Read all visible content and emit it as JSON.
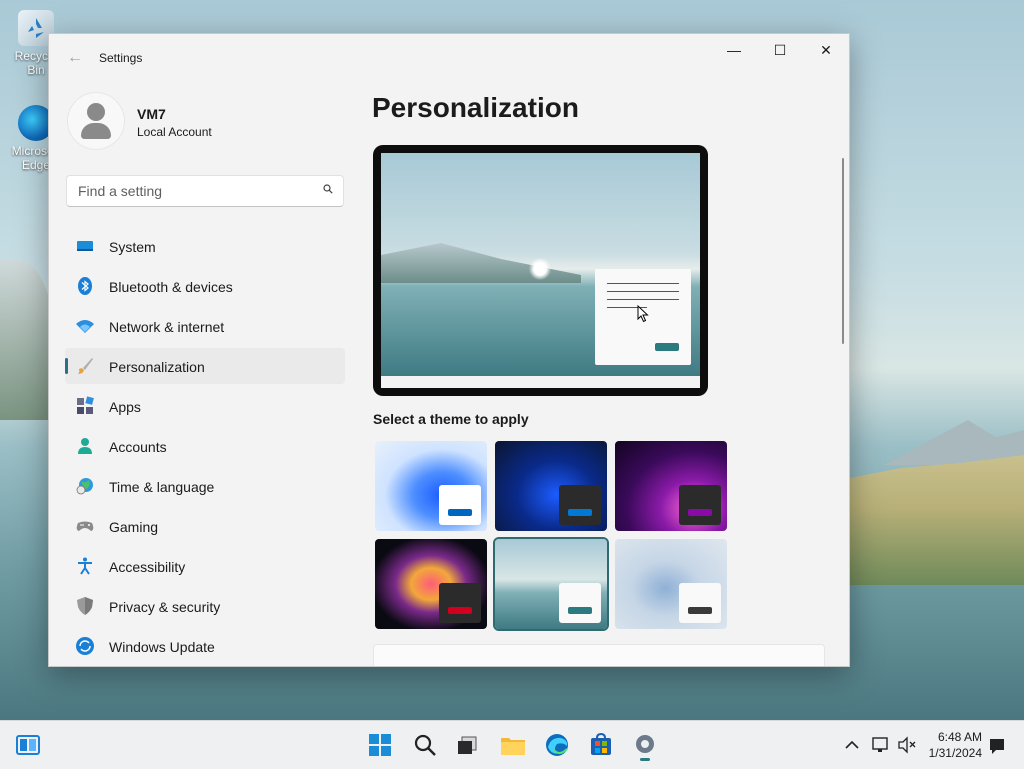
{
  "desktop": {
    "icons": [
      {
        "label": "Recycle Bin"
      },
      {
        "label": "Microsoft Edge"
      }
    ]
  },
  "window": {
    "title": "Settings",
    "controls": {
      "minimize": "—",
      "maximize": "☐",
      "close": "✕"
    },
    "back_glyph": "←"
  },
  "user": {
    "name": "VM7",
    "account_type": "Local Account"
  },
  "search": {
    "placeholder": "Find a setting"
  },
  "sidebar": {
    "items": [
      {
        "label": "System",
        "icon": "monitor-icon"
      },
      {
        "label": "Bluetooth & devices",
        "icon": "bluetooth-icon"
      },
      {
        "label": "Network & internet",
        "icon": "wifi-icon"
      },
      {
        "label": "Personalization",
        "icon": "brush-icon",
        "active": true
      },
      {
        "label": "Apps",
        "icon": "apps-icon"
      },
      {
        "label": "Accounts",
        "icon": "person-icon"
      },
      {
        "label": "Time & language",
        "icon": "globe-clock-icon"
      },
      {
        "label": "Gaming",
        "icon": "gamepad-icon"
      },
      {
        "label": "Accessibility",
        "icon": "accessibility-icon"
      },
      {
        "label": "Privacy & security",
        "icon": "shield-icon"
      },
      {
        "label": "Windows Update",
        "icon": "update-icon"
      }
    ]
  },
  "main": {
    "title": "Personalization",
    "theme_section_label": "Select a theme to apply",
    "themes": [
      {
        "name": "windows-light",
        "accent": "#0067c0"
      },
      {
        "name": "windows-dark",
        "accent": "#0078d4"
      },
      {
        "name": "glow",
        "accent": "#8a0aa8"
      },
      {
        "name": "captured-motion",
        "accent": "#d1001f"
      },
      {
        "name": "flow",
        "accent": "#2b7a80",
        "selected": true
      },
      {
        "name": "sunrise",
        "accent": "#3a3a3a"
      }
    ]
  },
  "taskbar": {
    "time": "6:48 AM",
    "date": "1/31/2024"
  }
}
